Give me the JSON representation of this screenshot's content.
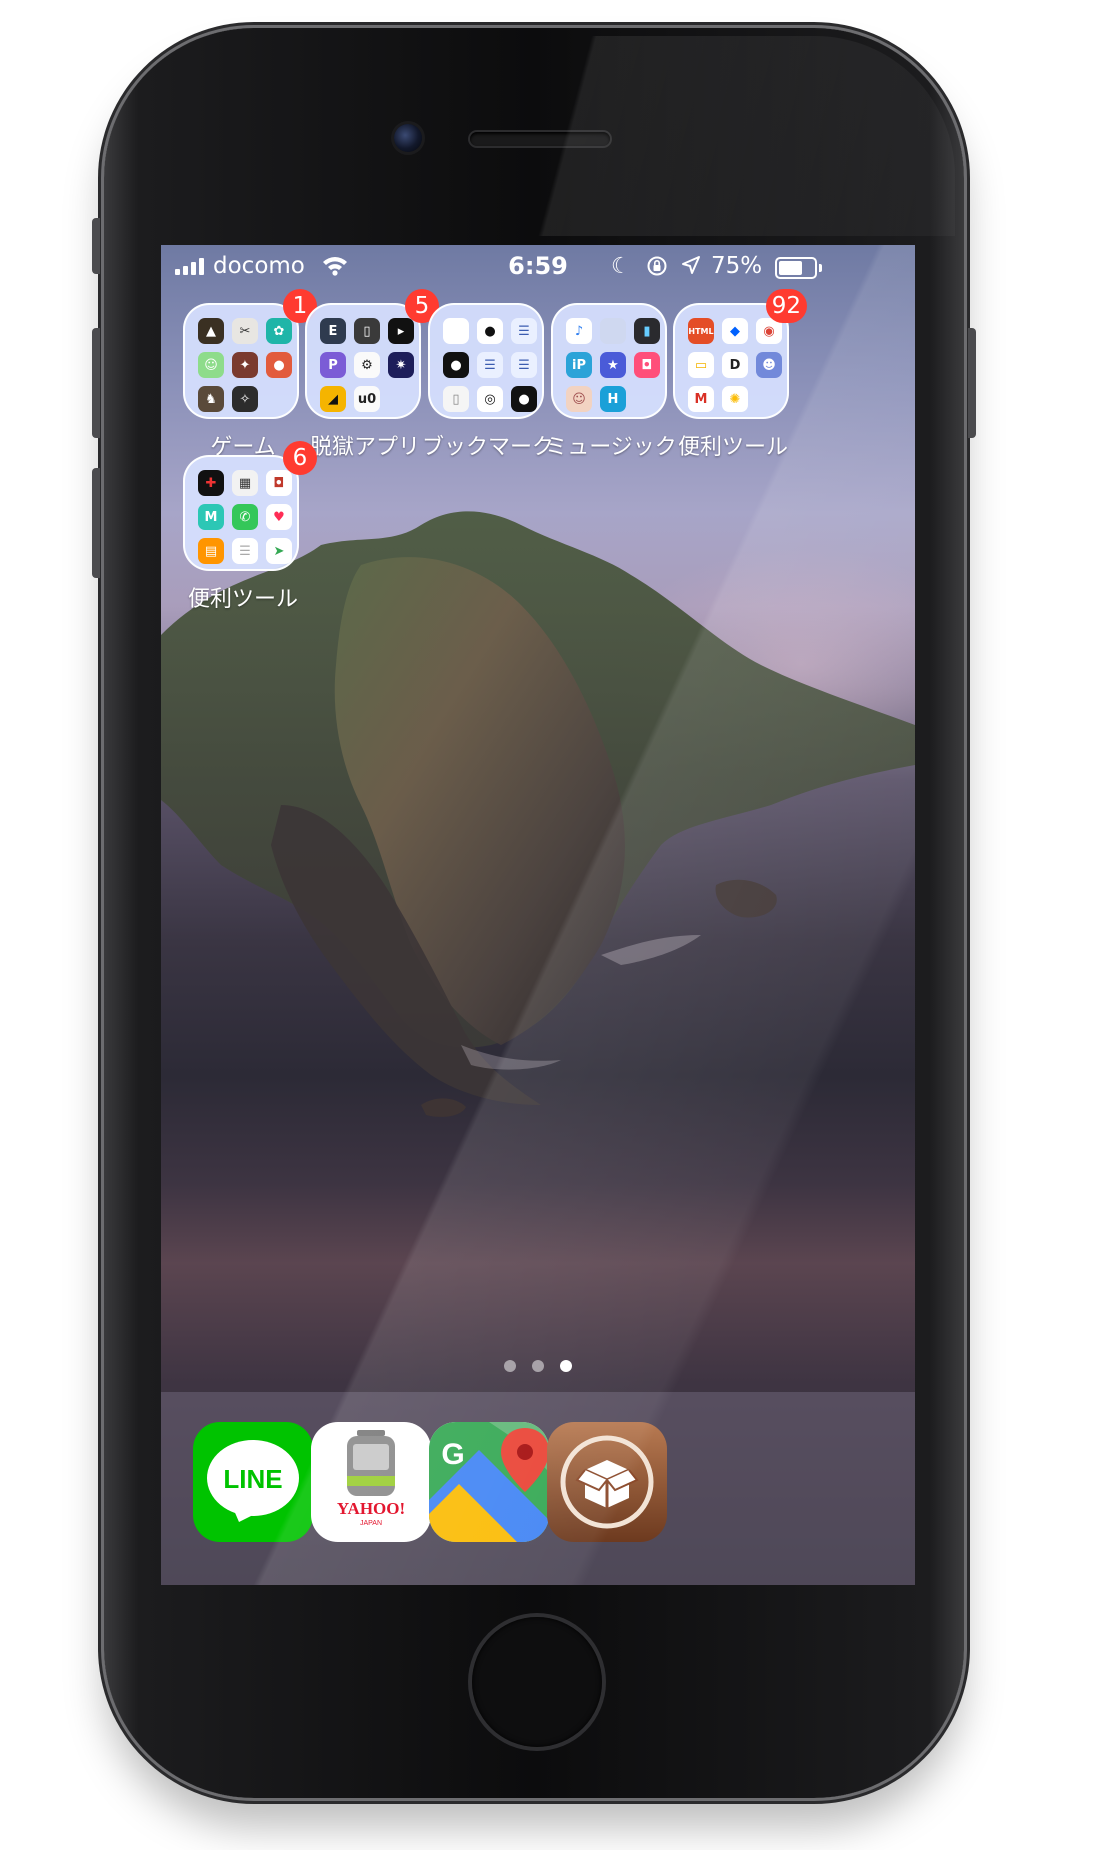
{
  "status_bar": {
    "carrier": "docomo",
    "time": "6:59",
    "battery_percent": "75%",
    "battery_level": 0.75,
    "signal_bars": 4,
    "icons": [
      "signal-icon",
      "wifi-icon",
      "moon-icon",
      "orientation-lock-icon",
      "location-icon",
      "battery-icon"
    ]
  },
  "folders": [
    {
      "label": "ゲーム",
      "badge": "1"
    },
    {
      "label": "脱獄アプリ",
      "badge": "5"
    },
    {
      "label": "ブックマーク",
      "badge": ""
    },
    {
      "label": "ミュージック",
      "badge": ""
    },
    {
      "label": "便利ツール",
      "badge": "92"
    },
    {
      "label": "便利ツール",
      "badge": "6"
    }
  ],
  "page_indicator": {
    "pages": 3,
    "current": 3
  },
  "dock": {
    "apps": [
      {
        "name": "LINE",
        "icon_text": "LINE",
        "color": "#00c300"
      },
      {
        "name": "Yahoo! Japan transit",
        "icon_text": "YAHOO!",
        "icon_subtext": "JAPAN",
        "color": "#ffffff"
      },
      {
        "name": "Google Maps",
        "icon_text": "G",
        "color": "#4285f4"
      },
      {
        "name": "Cydia",
        "icon": "cydia-box-icon",
        "color": "#8b4a2b"
      }
    ]
  },
  "colors": {
    "badge": "#ff3b30",
    "folder_bg": "#d7e1ff"
  }
}
